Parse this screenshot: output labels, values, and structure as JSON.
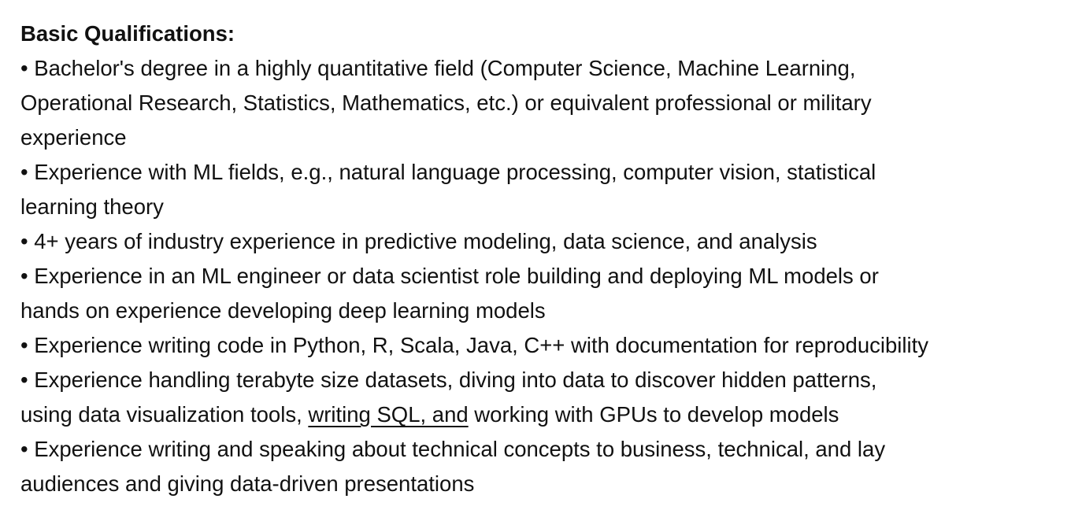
{
  "heading": "Basic Qualifications:",
  "lines": [
    "• Bachelor's degree in a highly quantitative field (Computer Science, Machine Learning,",
    "Operational Research, Statistics, Mathematics, etc.) or equivalent professional or military",
    "experience",
    "• Experience with ML fields, e.g., natural language processing, computer vision, statistical",
    "learning theory",
    "• 4+ years of industry experience in predictive modeling, data science, and analysis",
    "• Experience in an ML engineer or data scientist role building and deploying ML models or",
    "hands on experience developing deep learning models",
    "• Experience writing code in Python, R, Scala, Java, C++ with documentation for reproducibility",
    "• Experience handling terabyte size datasets, diving into data to discover hidden patterns,"
  ],
  "line_sql": {
    "before": "using data visualization tools, ",
    "underlined": "writing SQL, and",
    "after": " working with GPUs to develop models"
  },
  "lines_end": [
    "• Experience writing and speaking about technical concepts to business, technical, and lay",
    "audiences and giving data-driven presentations"
  ]
}
